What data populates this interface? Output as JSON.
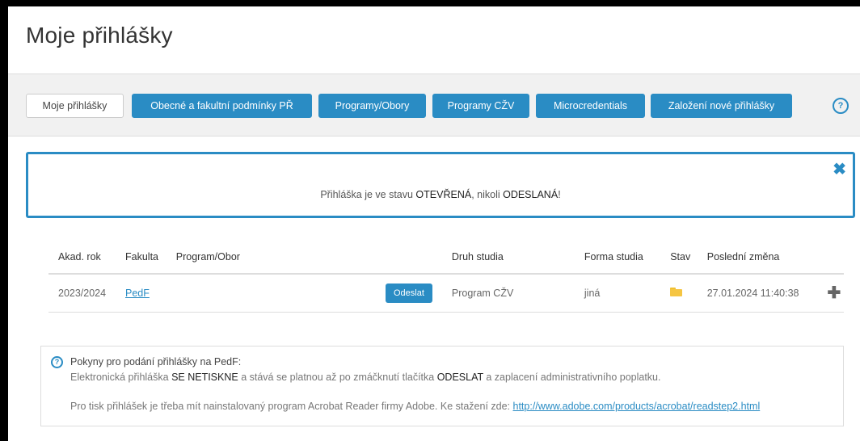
{
  "page": {
    "title": "Moje přihlášky"
  },
  "nav": {
    "items": [
      {
        "label": "Moje přihlášky"
      },
      {
        "label": "Obecné a fakultní podmínky PŘ"
      },
      {
        "label": "Programy/Obory"
      },
      {
        "label": "Programy CŽV"
      },
      {
        "label": "Microcredentials"
      },
      {
        "label": "Založení nové přihlášky"
      }
    ],
    "help_icon": "question-circle-icon",
    "help_glyph": "?"
  },
  "alert": {
    "text_prefix": "Přihláška je ve stavu ",
    "state_open": "OTEVŘENÁ",
    "text_middle": ", nikoli ",
    "state_sent": "ODESLANÁ",
    "text_suffix": "!",
    "close_glyph": "✖",
    "close_icon": "close-icon"
  },
  "table": {
    "headers": [
      "Akad. rok",
      "Fakulta",
      "Program/Obor",
      "Druh studia",
      "Forma studia",
      "Stav",
      "Poslední změna"
    ],
    "rows": [
      {
        "year": "2023/2024",
        "faculty": "PedF",
        "program": "",
        "send_label": "Odeslat",
        "study_type": "Program CŽV",
        "study_form": "jiná",
        "status_icon": "folder-icon",
        "last_change": "27.01.2024 11:40:38",
        "expand_glyph": "✚",
        "expand_icon": "plus-icon"
      }
    ]
  },
  "info": {
    "icon": "question-circle-icon",
    "title": "Pokyny pro podání přihlášky na PedF:",
    "line1_a": "Elektronická přihláška ",
    "line1_b": "SE NETISKNE",
    "line1_c": " a stává se platnou až po zmáčknutí tlačítka ",
    "line1_d": "ODESLAT",
    "line1_e": " a zaplacení administrativního poplatku.",
    "line2_text": "Pro tisk přihlášek je třeba mít nainstalovaný program Acrobat Reader firmy Adobe. Ke stažení zde: ",
    "line2_link": "http://www.adobe.com/products/acrobat/readstep2.html"
  },
  "colors": {
    "accent": "#2a8cc4",
    "folder": "#f5c542"
  }
}
